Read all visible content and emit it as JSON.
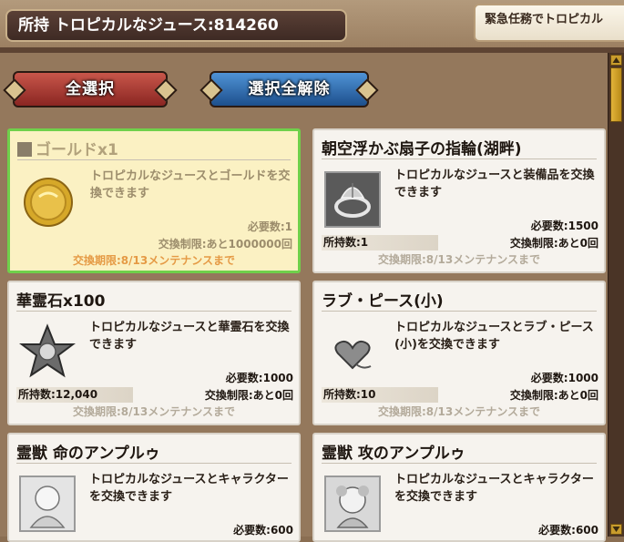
{
  "header": {
    "owned_label": "所持 トロピカルなジュース:814260",
    "mission_label": "緊急任務でトロピカル"
  },
  "buttons": {
    "select_all": "全選択",
    "deselect_all": "選択全解除"
  },
  "cards": [
    {
      "title": "ゴールドx1",
      "selected": true,
      "desc": "トロピカルなジュースとゴールドを交換できます",
      "required": "必要数:1",
      "limit": "交換制限:あと1000000回",
      "owned": "",
      "period": "交換期限:8/13メンテナンスまで",
      "icon": "gold-coin-icon"
    },
    {
      "title": "朝空浮かぶ扇子の指輪(湖畔)",
      "selected": false,
      "desc": "トロピカルなジュースと装備品を交換できます",
      "required": "必要数:1500",
      "limit": "交換制限:あと0回",
      "owned": "所持数:1",
      "period": "交換期限:8/13メンテナンスまで",
      "icon": "ring-icon"
    },
    {
      "title": "華霊石x100",
      "selected": false,
      "desc": "トロピカルなジュースと華霊石を交換できます",
      "required": "必要数:1000",
      "limit": "交換制限:あと0回",
      "owned": "所持数:12,040",
      "period": "交換期限:8/13メンテナンスまで",
      "icon": "spirit-crystal-icon"
    },
    {
      "title": "ラブ・ピース(小)",
      "selected": false,
      "desc": "トロピカルなジュースとラブ・ピース(小)を交換できます",
      "required": "必要数:1000",
      "limit": "交換制限:あと0回",
      "owned": "所持数:10",
      "period": "交換期限:8/13メンテナンスまで",
      "icon": "heart-piece-icon"
    },
    {
      "title": "霊獣 命のアンプルゥ",
      "selected": false,
      "desc": "トロピカルなジュースとキャラクターを交換できます",
      "required": "必要数:600",
      "limit": "",
      "owned": "",
      "period": "",
      "icon": "spirit-beast-life-icon"
    },
    {
      "title": "霊獣 攻のアンプルゥ",
      "selected": false,
      "desc": "トロピカルなジュースとキャラクターを交換できます",
      "required": "必要数:600",
      "limit": "",
      "owned": "",
      "period": "",
      "icon": "spirit-beast-attack-icon"
    }
  ]
}
